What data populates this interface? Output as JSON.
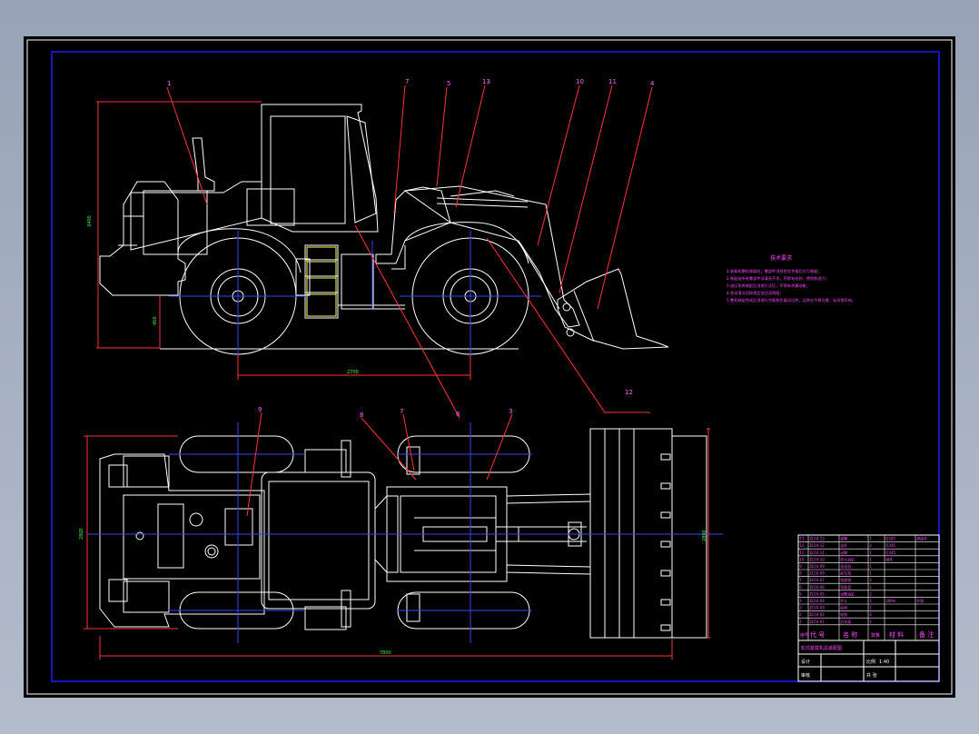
{
  "drawing": {
    "balloons_side": [
      "1",
      "7",
      "5",
      "13",
      "10",
      "11",
      "4"
    ],
    "balloon_bucket_lower": "12",
    "balloons_top": [
      "9",
      "8",
      "7",
      "3"
    ],
    "balloon_side_mid": "6",
    "dim_height": "3400",
    "dim_ground": "450",
    "dim_wheelbase": "2700",
    "dim_top_width": "2800",
    "dim_overall_length": "7800",
    "dim_bucket_width": "2800"
  },
  "notes": {
    "title": "技术要求",
    "lines": [
      "1.装载机整机装配时，零部件须经检验合格后方可装配；",
      "2.装配前所有零部件须清洗干净，不得有毛刺、锈蚀和油污；",
      "3.液压系统装配后须进行试压，不得有渗漏现象；",
      "4.各润滑点须按规定加注润滑脂；",
      "5.整机装配完成后须进行空载和负载试运转，运转应平稳可靠，无异常声响。"
    ]
  },
  "bom": {
    "rows": [
      {
        "no": "13",
        "code": "ZL50-13",
        "name": "摇臂",
        "qty": "1",
        "material": "Q345",
        "note": "焊接件"
      },
      {
        "no": "12",
        "code": "ZL50-12",
        "name": "连杆",
        "qty": "2",
        "material": "Q345",
        "note": ""
      },
      {
        "no": "11",
        "code": "ZL50-11",
        "name": "动臂",
        "qty": "1",
        "material": "Q345",
        "note": ""
      },
      {
        "no": "10",
        "code": "ZL50-10",
        "name": "转斗油缸",
        "qty": "1",
        "material": "组件",
        "note": ""
      },
      {
        "no": "9",
        "code": "ZL50-09",
        "name": "发动机",
        "qty": "1",
        "material": "",
        "note": ""
      },
      {
        "no": "8",
        "code": "ZL50-08",
        "name": "前车架",
        "qty": "1",
        "material": "",
        "note": ""
      },
      {
        "no": "7",
        "code": "ZL50-07",
        "name": "铰接销",
        "qty": "2",
        "material": "",
        "note": ""
      },
      {
        "no": "6",
        "code": "ZL50-06",
        "name": "驾驶室",
        "qty": "1",
        "material": "",
        "note": ""
      },
      {
        "no": "5",
        "code": "ZL50-05",
        "name": "动臂油缸",
        "qty": "2",
        "material": "",
        "note": ""
      },
      {
        "no": "4",
        "code": "ZL50-04",
        "name": "铲斗",
        "qty": "1",
        "material": "16Mn",
        "note": "外购"
      },
      {
        "no": "3",
        "code": "ZL50-03",
        "name": "前桥",
        "qty": "1",
        "material": "",
        "note": ""
      },
      {
        "no": "2",
        "code": "ZL50-02",
        "name": "轮胎",
        "qty": "4",
        "material": "",
        "note": ""
      },
      {
        "no": "1",
        "code": "ZL50-01",
        "name": "后车架",
        "qty": "1",
        "material": "",
        "note": ""
      }
    ],
    "header": {
      "no": "序号",
      "code": "代 号",
      "name": "名 称",
      "qty": "数量",
      "material": "材 料",
      "note": "备 注"
    }
  },
  "title_block": {
    "project": "轮式装载机总装配图",
    "designer_label": "设计",
    "checker_label": "审核",
    "scale_label": "比例",
    "scale_value": "1:40",
    "sheet_label": "共 张"
  }
}
